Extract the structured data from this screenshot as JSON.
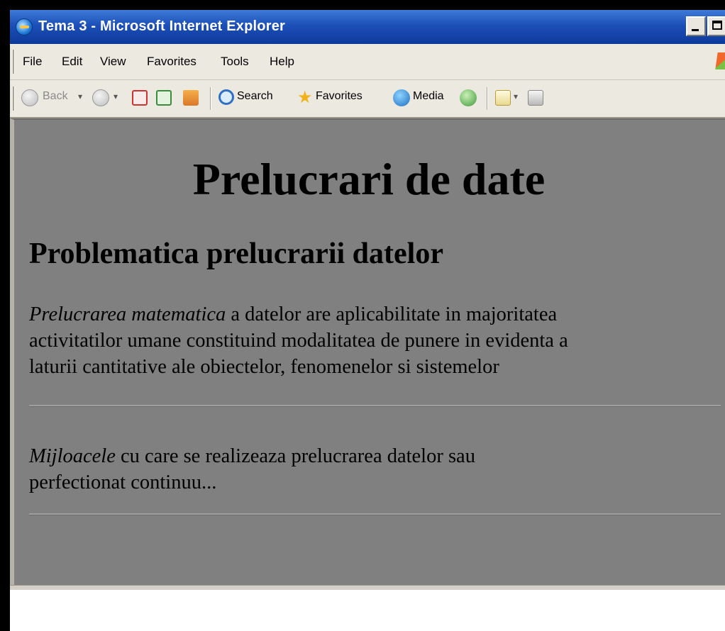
{
  "window": {
    "title": "Tema 3 - Microsoft Internet Explorer"
  },
  "menu": {
    "items": [
      "File",
      "Edit",
      "View",
      "Favorites",
      "Tools",
      "Help"
    ]
  },
  "toolbar": {
    "back_label": "Back",
    "search_label": "Search",
    "favorites_label": "Favorites",
    "media_label": "Media"
  },
  "page": {
    "heading": "Prelucrari de date",
    "subheading": "Problematica prelucrarii datelor",
    "paragraph1": {
      "emphasis": "Prelucrarea matematica",
      "line1_rest": " a datelor are aplicabilitate in majoritatea",
      "line2": "activitatilor umane constituind modalitatea de punere in evidenta a",
      "line3": "laturii cantitative ale obiectelor, fenomenelor si sistemelor"
    },
    "paragraph2": {
      "emphasis": "Mijloacele",
      "line1_rest": " cu care se realizeaza prelucrarea datelor sau",
      "line2": "perfectionat continuu..."
    }
  },
  "colors": {
    "titlebar": "#1c4fb8",
    "chrome": "#ece9e1",
    "page_background": "#808080"
  },
  "icons": [
    "ie-icon",
    "back-arrow-icon",
    "forward-arrow-icon",
    "stop-icon",
    "refresh-icon",
    "home-icon",
    "search-icon",
    "favorites-star-icon",
    "media-icon",
    "history-icon",
    "mail-icon",
    "print-icon",
    "windows-logo-icon"
  ]
}
